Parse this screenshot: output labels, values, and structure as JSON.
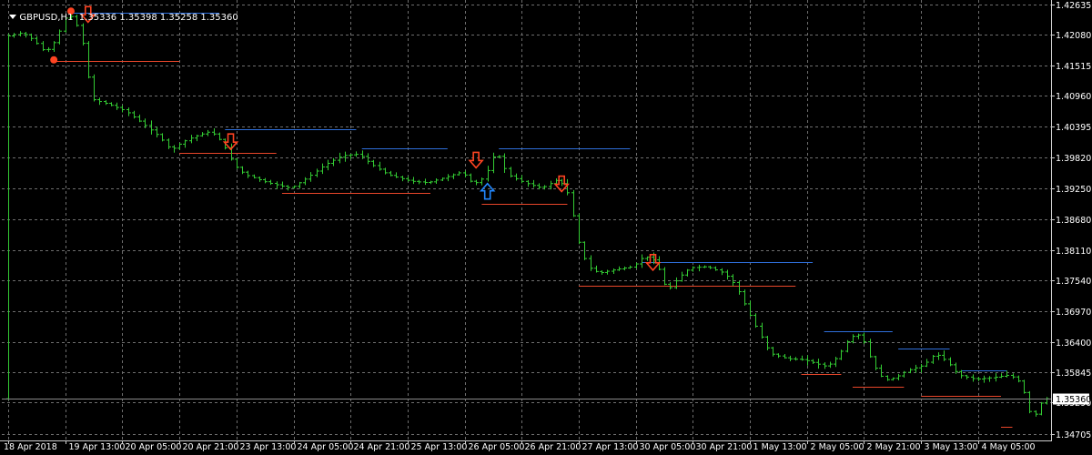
{
  "header": {
    "symbol": "GBPUSD,H1",
    "ohlc": "1.35336 1.35398 1.35258 1.35360"
  },
  "colors": {
    "background": "#000000",
    "grid": "#6e6e6e",
    "axis_text": "#ffffff",
    "bar_up": "#33cc33",
    "bar_down": "#33cc33",
    "resistance": "#2f6fdb",
    "support": "#e8462a",
    "arrow_down": "#ff4422",
    "arrow_up": "#2288ff",
    "marker": "#ff4422",
    "price_tag_bg": "#ffffff",
    "price_tag_text": "#000000"
  },
  "chart_data": {
    "type": "line",
    "title": "GBPUSD,H1",
    "ylim": [
      1.3459,
      1.42725
    ],
    "xlim": [
      0,
      183
    ],
    "grid": true,
    "x_tick_labels": [
      {
        "bar": 0,
        "label": "18 Apr 2018"
      },
      {
        "bar": 10,
        "label": "19 Apr 13:00"
      },
      {
        "bar": 20,
        "label": "20 Apr 05:00"
      },
      {
        "bar": 30,
        "label": "20 Apr 21:00"
      },
      {
        "bar": 40,
        "label": "23 Apr 13:00"
      },
      {
        "bar": 50,
        "label": "24 Apr 05:00"
      },
      {
        "bar": 60,
        "label": "24 Apr 21:00"
      },
      {
        "bar": 70,
        "label": "25 Apr 13:00"
      },
      {
        "bar": 80,
        "label": "26 Apr 05:00"
      },
      {
        "bar": 90,
        "label": "26 Apr 21:00"
      },
      {
        "bar": 100,
        "label": "27 Apr 13:00"
      },
      {
        "bar": 110,
        "label": "30 Apr 05:00"
      },
      {
        "bar": 120,
        "label": "30 Apr 21:00"
      },
      {
        "bar": 130,
        "label": "1 May 13:00"
      },
      {
        "bar": 140,
        "label": "2 May 05:00"
      },
      {
        "bar": 150,
        "label": "2 May 21:00"
      },
      {
        "bar": 160,
        "label": "3 May 13:00"
      },
      {
        "bar": 170,
        "label": "4 May 05:00"
      }
    ],
    "y_tick_labels": [
      "1.42635",
      "1.42080",
      "1.41515",
      "1.40960",
      "1.40395",
      "1.39820",
      "1.39250",
      "1.38680",
      "1.38110",
      "1.37540",
      "1.36970",
      "1.36400",
      "1.35845",
      "1.35290",
      "1.34705"
    ],
    "y_tick_values": [
      1.42635,
      1.4208,
      1.41515,
      1.4096,
      1.40395,
      1.3982,
      1.3925,
      1.3868,
      1.3811,
      1.3754,
      1.3697,
      1.364,
      1.35845,
      1.3529,
      1.34705
    ],
    "current_price": "1.35360",
    "price_keyframes": [
      [
        0,
        1.4205
      ],
      [
        3,
        1.4212
      ],
      [
        5,
        1.4198
      ],
      [
        7,
        1.4175
      ],
      [
        9,
        1.42
      ],
      [
        10,
        1.423
      ],
      [
        11,
        1.4248
      ],
      [
        12,
        1.4236
      ],
      [
        13,
        1.4215
      ],
      [
        14,
        1.417
      ],
      [
        15,
        1.409
      ],
      [
        18,
        1.408
      ],
      [
        21,
        1.4068
      ],
      [
        24,
        1.4045
      ],
      [
        27,
        1.402
      ],
      [
        29,
        1.3995
      ],
      [
        31,
        1.401
      ],
      [
        33,
        1.402
      ],
      [
        36,
        1.403
      ],
      [
        38,
        1.401
      ],
      [
        40,
        1.3968
      ],
      [
        42,
        1.395
      ],
      [
        46,
        1.3935
      ],
      [
        50,
        1.3925
      ],
      [
        53,
        1.3945
      ],
      [
        56,
        1.3968
      ],
      [
        59,
        1.3985
      ],
      [
        62,
        1.3988
      ],
      [
        64,
        1.397
      ],
      [
        67,
        1.395
      ],
      [
        71,
        1.3938
      ],
      [
        74,
        1.3935
      ],
      [
        78,
        1.3948
      ],
      [
        80,
        1.3955
      ],
      [
        82,
        1.3932
      ],
      [
        84,
        1.3945
      ],
      [
        86,
        1.3995
      ],
      [
        88,
        1.395
      ],
      [
        91,
        1.3935
      ],
      [
        94,
        1.3925
      ],
      [
        97,
        1.3942
      ],
      [
        99,
        1.3908
      ],
      [
        100,
        1.384
      ],
      [
        102,
        1.378
      ],
      [
        104,
        1.3768
      ],
      [
        107,
        1.3775
      ],
      [
        110,
        1.378
      ],
      [
        112,
        1.38
      ],
      [
        114,
        1.379
      ],
      [
        115,
        1.376
      ],
      [
        116,
        1.3735
      ],
      [
        118,
        1.376
      ],
      [
        120,
        1.3778
      ],
      [
        123,
        1.378
      ],
      [
        126,
        1.3768
      ],
      [
        128,
        1.3745
      ],
      [
        130,
        1.37
      ],
      [
        132,
        1.366
      ],
      [
        134,
        1.362
      ],
      [
        137,
        1.361
      ],
      [
        140,
        1.3608
      ],
      [
        144,
        1.3595
      ],
      [
        146,
        1.3615
      ],
      [
        148,
        1.365
      ],
      [
        150,
        1.3655
      ],
      [
        152,
        1.36
      ],
      [
        154,
        1.357
      ],
      [
        156,
        1.3575
      ],
      [
        158,
        1.3588
      ],
      [
        161,
        1.3598
      ],
      [
        163,
        1.362
      ],
      [
        165,
        1.3605
      ],
      [
        167,
        1.358
      ],
      [
        170,
        1.3572
      ],
      [
        173,
        1.3575
      ],
      [
        176,
        1.358
      ],
      [
        178,
        1.3565
      ],
      [
        179,
        1.353
      ],
      [
        180,
        1.3495
      ],
      [
        181,
        1.352
      ],
      [
        182,
        1.3536
      ]
    ],
    "levels": [
      {
        "kind": "resistance",
        "price": 1.42495,
        "from": 11,
        "to": 37
      },
      {
        "kind": "support",
        "price": 1.41595,
        "from": 8,
        "to": 30
      },
      {
        "kind": "resistance",
        "price": 1.40345,
        "from": 38,
        "to": 61
      },
      {
        "kind": "support",
        "price": 1.39905,
        "from": 30,
        "to": 47
      },
      {
        "kind": "resistance",
        "price": 1.39985,
        "from": 62,
        "to": 77
      },
      {
        "kind": "support",
        "price": 1.39165,
        "from": 48,
        "to": 74
      },
      {
        "kind": "resistance",
        "price": 1.39985,
        "from": 86,
        "to": 109
      },
      {
        "kind": "support",
        "price": 1.3896,
        "from": 83,
        "to": 98
      },
      {
        "kind": "resistance",
        "price": 1.3789,
        "from": 111,
        "to": 141
      },
      {
        "kind": "support",
        "price": 1.37455,
        "from": 100,
        "to": 138
      },
      {
        "kind": "resistance",
        "price": 1.3661,
        "from": 143,
        "to": 155
      },
      {
        "kind": "support",
        "price": 1.35815,
        "from": 139,
        "to": 146
      },
      {
        "kind": "resistance",
        "price": 1.3629,
        "from": 156,
        "to": 165
      },
      {
        "kind": "support",
        "price": 1.35585,
        "from": 148,
        "to": 157
      },
      {
        "kind": "resistance",
        "price": 1.3589,
        "from": 167,
        "to": 175
      },
      {
        "kind": "support",
        "price": 1.35415,
        "from": 160,
        "to": 174
      },
      {
        "kind": "support",
        "price": 1.34845,
        "from": 174,
        "to": 176
      }
    ],
    "arrows": [
      {
        "dir": "down",
        "bar": 14,
        "price": 1.4245
      },
      {
        "dir": "down",
        "bar": 39,
        "price": 1.401
      },
      {
        "dir": "down",
        "bar": 82,
        "price": 1.3976
      },
      {
        "dir": "up",
        "bar": 84,
        "price": 1.392
      },
      {
        "dir": "down",
        "bar": 97,
        "price": 1.3932
      },
      {
        "dir": "down",
        "bar": 113,
        "price": 1.3787
      }
    ],
    "markers": [
      {
        "bar": 11,
        "price": 1.4252
      },
      {
        "bar": 8,
        "price": 1.4162
      }
    ]
  }
}
